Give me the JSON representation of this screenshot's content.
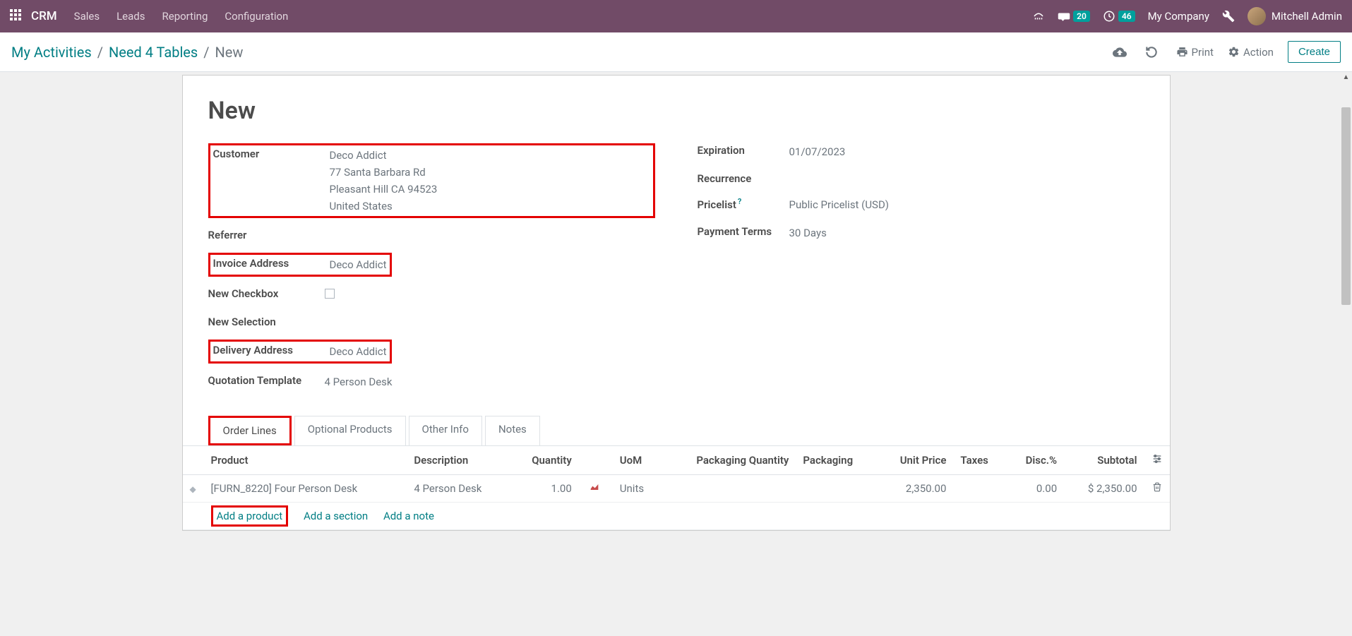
{
  "navbar": {
    "brand": "CRM",
    "menu": [
      "Sales",
      "Leads",
      "Reporting",
      "Configuration"
    ],
    "messages_badge": "20",
    "activities_badge": "46",
    "company": "My Company",
    "user": "Mitchell Admin"
  },
  "breadcrumb": {
    "items": [
      "My Activities",
      "Need 4 Tables",
      "New"
    ],
    "print": "Print",
    "action": "Action",
    "create": "Create"
  },
  "form": {
    "title": "New",
    "left": {
      "customer_label": "Customer",
      "customer_name": "Deco Addict",
      "customer_street": "77 Santa Barbara Rd",
      "customer_city": "Pleasant Hill CA 94523",
      "customer_country": "United States",
      "referrer_label": "Referrer",
      "invoice_label": "Invoice Address",
      "invoice_value": "Deco Addict",
      "checkbox_label": "New Checkbox",
      "selection_label": "New Selection",
      "delivery_label": "Delivery Address",
      "delivery_value": "Deco Addict",
      "template_label": "Quotation Template",
      "template_value": "4 Person Desk"
    },
    "right": {
      "expiration_label": "Expiration",
      "expiration_value": "01/07/2023",
      "recurrence_label": "Recurrence",
      "pricelist_label": "Pricelist",
      "pricelist_value": "Public Pricelist (USD)",
      "payment_label": "Payment Terms",
      "payment_value": "30 Days"
    }
  },
  "tabs": [
    "Order Lines",
    "Optional Products",
    "Other Info",
    "Notes"
  ],
  "table": {
    "headers": {
      "product": "Product",
      "description": "Description",
      "quantity": "Quantity",
      "uom": "UoM",
      "pack_qty": "Packaging Quantity",
      "packaging": "Packaging",
      "unit_price": "Unit Price",
      "taxes": "Taxes",
      "disc": "Disc.%",
      "subtotal": "Subtotal"
    },
    "row": {
      "product": "[FURN_8220] Four Person Desk",
      "description": "4 Person Desk",
      "quantity": "1.00",
      "uom": "Units",
      "unit_price": "2,350.00",
      "disc": "0.00",
      "subtotal": "$ 2,350.00"
    },
    "add_product": "Add a product",
    "add_section": "Add a section",
    "add_note": "Add a note"
  }
}
